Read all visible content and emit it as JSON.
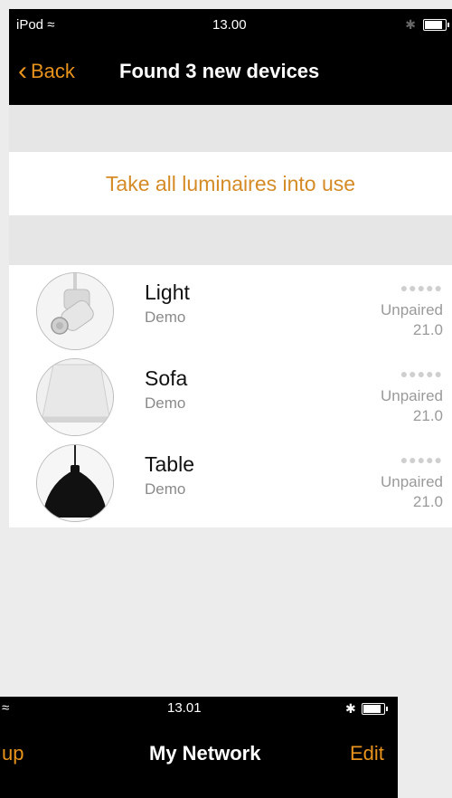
{
  "screen1": {
    "status": {
      "carrier": "iPod",
      "time": "13.00"
    },
    "nav": {
      "back_label": "Back",
      "title": "Found 3 new devices"
    },
    "action_label": "Take all luminaires into use",
    "devices": [
      {
        "name": "Light",
        "sub": "Demo",
        "signal": "●●●●●",
        "status": "Unpaired",
        "value": "21.0",
        "icon": "spotlight-thumb"
      },
      {
        "name": "Sofa",
        "sub": "Demo",
        "signal": "●●●●●",
        "status": "Unpaired",
        "value": "21.0",
        "icon": "floor-lamp-shade-thumb"
      },
      {
        "name": "Table",
        "sub": "Demo",
        "signal": "●●●●●",
        "status": "Unpaired",
        "value": "21.0",
        "icon": "pendant-lamp-thumb"
      }
    ],
    "accent": "#e8931c"
  },
  "screen2": {
    "status": {
      "time": "13.01"
    },
    "nav": {
      "back_label": "up",
      "title": "My Network",
      "edit_label": "Edit"
    }
  }
}
